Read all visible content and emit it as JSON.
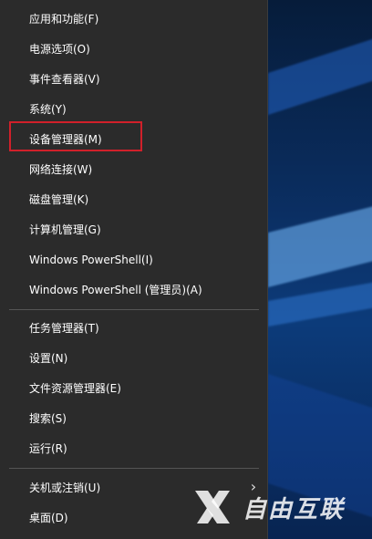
{
  "menu": {
    "items": [
      {
        "label": "应用和功能(F)"
      },
      {
        "label": "电源选项(O)"
      },
      {
        "label": "事件查看器(V)"
      },
      {
        "label": "系统(Y)"
      },
      {
        "label": "设备管理器(M)",
        "highlighted": true
      },
      {
        "label": "网络连接(W)"
      },
      {
        "label": "磁盘管理(K)"
      },
      {
        "label": "计算机管理(G)"
      },
      {
        "label": "Windows PowerShell(I)"
      },
      {
        "label": "Windows PowerShell (管理员)(A)"
      },
      {
        "label": "任务管理器(T)"
      },
      {
        "label": "设置(N)"
      },
      {
        "label": "文件资源管理器(E)"
      },
      {
        "label": "搜索(S)"
      },
      {
        "label": "运行(R)"
      },
      {
        "label": "关机或注销(U)",
        "has_submenu": true
      },
      {
        "label": "桌面(D)"
      }
    ],
    "background": "#2b2b2b",
    "text_color": "#ffffff",
    "highlight_border_color": "#d1202a",
    "submenu_icon": "chevron-right-icon"
  },
  "watermark": {
    "text": "自由互联",
    "icon": "x-logo-icon"
  }
}
